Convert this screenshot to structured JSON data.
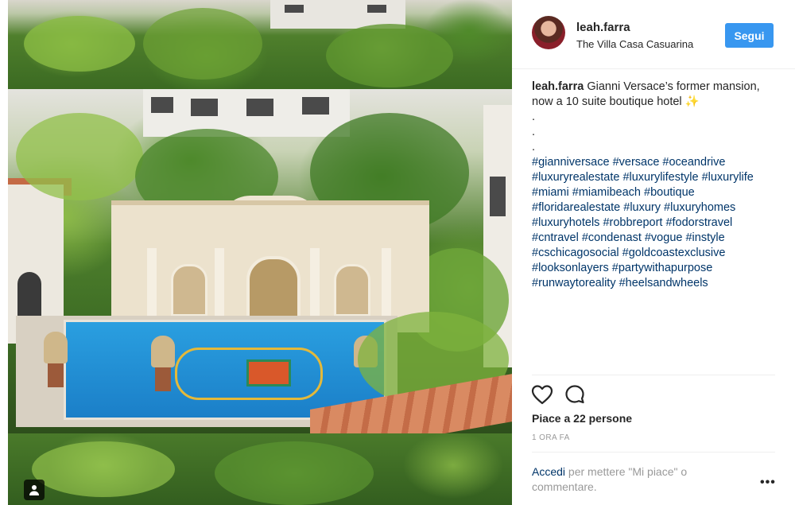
{
  "post": {
    "image_alt": "Gianni Versace mansion pool"
  },
  "header": {
    "username": "leah.farra",
    "location": "The Villa Casa Casuarina",
    "follow_label": "Segui"
  },
  "caption": {
    "username": "leah.farra",
    "text": "Gianni Versace’s former mansion, now a 10 suite boutique hotel ✨",
    "dots": [
      ".",
      ".",
      "."
    ],
    "hashtags": "#gianniversace #versace #oceandrive #luxuryrealestate #luxurylifestyle #luxurylife #miami #miamibeach #boutique #floridarealestate #luxury #luxuryhomes #luxuryhotels #robbreport #fodorstravel #cntravel #condenast #vogue #instyle #cschicagosocial #goldcoastexclusive #looksonlayers #partywithapurpose #runwaytoreality #heelsandwheels"
  },
  "actions": {
    "like_icon": "heart-icon",
    "comment_icon": "comment-icon"
  },
  "likes": {
    "text": "Piace a 22 persone"
  },
  "time": {
    "text": "1 ORA FA"
  },
  "login": {
    "link": "Accedi",
    "rest": " per mettere \"Mi piace\" o commentare."
  },
  "more": {
    "label": "•••"
  }
}
